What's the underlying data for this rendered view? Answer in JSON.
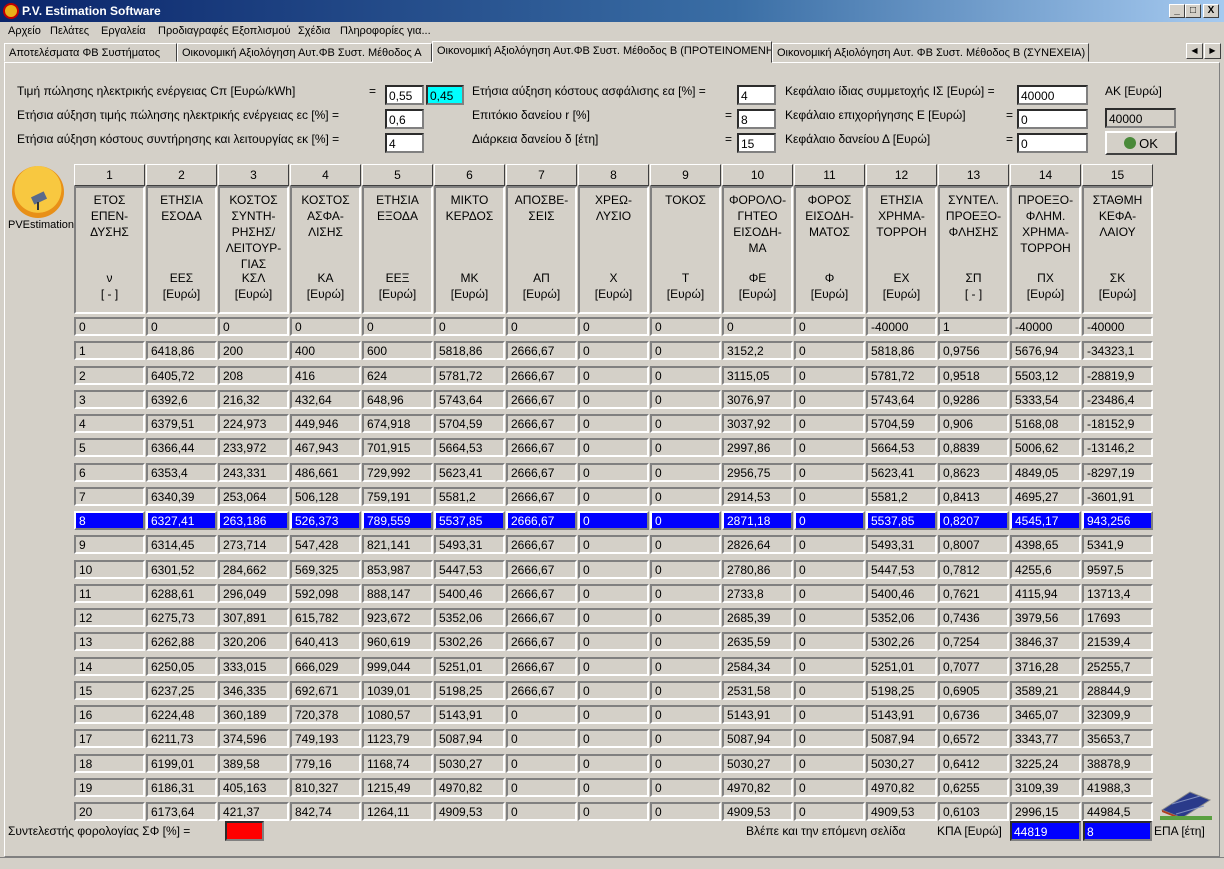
{
  "window": {
    "title": "P.V. Estimation Software",
    "min": "_",
    "max": "□",
    "close": "X"
  },
  "menu": [
    "Αρχείο",
    "Πελάτες",
    "Εργαλεία",
    "Προδιαγραφές Εξοπλισμού",
    "Σχέδια",
    "Πληροφορίες για..."
  ],
  "tabs": [
    "Αποτελέσματα ΦΒ Συστήματος",
    "Οικονομική Αξιολόγηση Αυτ.ΦΒ Συστ. Μέθοδος Α",
    "Οικονομική Αξιολόγηση Αυτ.ΦΒ Συστ. Μέθοδος Β (ΠΡΟΤΕΙΝΟΜΕΝΗ)",
    "Οικονομική Αξιολόγηση Αυτ. ΦΒ Συστ. Μέθοδος Β (ΣΥΝΕΧΕΙΑ)"
  ],
  "tab_arrows": {
    "left": "◀",
    "right": "▶"
  },
  "params": {
    "cn_label": "Τιμή πώλησης ηλεκτρικής ενέργειας Cπ [Ευρώ/kWh]",
    "cn_eq": "=",
    "cn_value": "0,55",
    "cn_value2": "0,45",
    "ec_label": "Ετήσια αύξηση τιμής πώλησης ηλεκτρικής ενέργειας εc [%] =",
    "ec_value": "0,6",
    "ek_label": "Ετήσια αύξηση κόστους συντήρησης και λειτουργίας εκ [%] =",
    "ek_value": "4",
    "ea_label": "Ετήσια αύξηση κόστους ασφάλισης εα [%] =",
    "ea_value": "4",
    "r_label": "Επιτόκιο δανείου r [%]",
    "r_eq": "=",
    "r_value": "8",
    "d_label": "Διάρκεια δανείου δ [έτη]",
    "d_eq": "=",
    "d_value": "15",
    "is_label": "Κεφάλαιο ίδιας συμμετοχής ΙΣ [Ευρώ] =",
    "is_value": "40000",
    "e_label": "Κεφάλαιο επιχορήγησης Ε [Ευρώ]",
    "e_eq": "=",
    "e_value": "0",
    "delta_label": "Κεφάλαιο δανείου Δ [Ευρώ]",
    "delta_eq": "=",
    "delta_value": "0",
    "ak_label": "ΑΚ [Ευρώ]",
    "ak_value": "40000",
    "ok_label": "OK"
  },
  "logo": {
    "caption": "PVEstimation"
  },
  "columns": [
    {
      "num": "1",
      "title": "ΕΤΟΣ\nΕΠΕΝ-\nΔΥΣΗΣ",
      "sym": "ν\n[ - ]"
    },
    {
      "num": "2",
      "title": "ΕΤΗΣΙΑ\nΕΣΟΔΑ",
      "sym": "ΕΕΣ\n[Ευρώ]"
    },
    {
      "num": "3",
      "title": "ΚΟΣΤΟΣ\nΣΥΝΤΗ-\nΡΗΣΗΣ/\nΛΕΙΤΟΥΡ-\nΓΙΑΣ",
      "sym": "ΚΣΛ\n[Ευρώ]"
    },
    {
      "num": "4",
      "title": "ΚΟΣΤΟΣ\nΑΣΦΑ-\nΛΙΣΗΣ",
      "sym": "ΚΑ\n[Ευρώ]"
    },
    {
      "num": "5",
      "title": "ΕΤΗΣΙΑ\nΕΞΟΔΑ",
      "sym": "ΕΕΞ\n[Ευρώ]"
    },
    {
      "num": "6",
      "title": "ΜΙΚΤΟ\nΚΕΡΔΟΣ",
      "sym": "ΜΚ\n[Ευρώ]"
    },
    {
      "num": "7",
      "title": "ΑΠΟΣΒΕ-\nΣΕΙΣ",
      "sym": "ΑΠ\n[Ευρώ]"
    },
    {
      "num": "8",
      "title": "ΧΡΕΩ-\nΛΥΣΙΟ",
      "sym": "Χ\n[Ευρώ]"
    },
    {
      "num": "9",
      "title": "ΤΟΚΟΣ",
      "sym": "Τ\n[Ευρώ]"
    },
    {
      "num": "10",
      "title": "ΦΟΡΟΛΟ-\nΓΗΤΕΟ\nΕΙΣΟΔΗ-\nΜΑ",
      "sym": "ΦΕ\n[Ευρώ]"
    },
    {
      "num": "11",
      "title": "ΦΟΡΟΣ\nΕΙΣΟΔΗ-\nΜΑΤΟΣ",
      "sym": "Φ\n[Ευρώ]"
    },
    {
      "num": "12",
      "title": "ΕΤΗΣΙΑ\nΧΡΗΜΑ-\nΤΟΡΡΟΗ",
      "sym": "ΕΧ\n[Ευρώ]"
    },
    {
      "num": "13",
      "title": "ΣΥΝΤΕΛ.\nΠΡΟΕΞΟ-\nΦΛΗΣΗΣ",
      "sym": "ΣΠ\n[ - ]"
    },
    {
      "num": "14",
      "title": "ΠΡΟΕΞΟ-\nΦΛΗΜ.\nΧΡΗΜΑ-\nΤΟΡΡΟΗ",
      "sym": "ΠΧ\n[Ευρώ]"
    },
    {
      "num": "15",
      "title": "ΣΤΑΘΜΗ\nΚΕΦΑ-\nΛΑΙΟΥ",
      "sym": "ΣΚ\n[Ευρώ]"
    }
  ],
  "selected_row": 8,
  "rows": [
    [
      "0",
      "0",
      "0",
      "0",
      "0",
      "0",
      "0",
      "0",
      "0",
      "0",
      "0",
      "-40000",
      "1",
      "-40000",
      "-40000"
    ],
    [
      "1",
      "6418,86",
      "200",
      "400",
      "600",
      "5818,86",
      "2666,67",
      "0",
      "0",
      "3152,2",
      "0",
      "5818,86",
      "0,9756",
      "5676,94",
      "-34323,1"
    ],
    [
      "2",
      "6405,72",
      "208",
      "416",
      "624",
      "5781,72",
      "2666,67",
      "0",
      "0",
      "3115,05",
      "0",
      "5781,72",
      "0,9518",
      "5503,12",
      "-28819,9"
    ],
    [
      "3",
      "6392,6",
      "216,32",
      "432,64",
      "648,96",
      "5743,64",
      "2666,67",
      "0",
      "0",
      "3076,97",
      "0",
      "5743,64",
      "0,9286",
      "5333,54",
      "-23486,4"
    ],
    [
      "4",
      "6379,51",
      "224,973",
      "449,946",
      "674,918",
      "5704,59",
      "2666,67",
      "0",
      "0",
      "3037,92",
      "0",
      "5704,59",
      "0,906",
      "5168,08",
      "-18152,9"
    ],
    [
      "5",
      "6366,44",
      "233,972",
      "467,943",
      "701,915",
      "5664,53",
      "2666,67",
      "0",
      "0",
      "2997,86",
      "0",
      "5664,53",
      "0,8839",
      "5006,62",
      "-13146,2"
    ],
    [
      "6",
      "6353,4",
      "243,331",
      "486,661",
      "729,992",
      "5623,41",
      "2666,67",
      "0",
      "0",
      "2956,75",
      "0",
      "5623,41",
      "0,8623",
      "4849,05",
      "-8297,19"
    ],
    [
      "7",
      "6340,39",
      "253,064",
      "506,128",
      "759,191",
      "5581,2",
      "2666,67",
      "0",
      "0",
      "2914,53",
      "0",
      "5581,2",
      "0,8413",
      "4695,27",
      "-3601,91"
    ],
    [
      "8",
      "6327,41",
      "263,186",
      "526,373",
      "789,559",
      "5537,85",
      "2666,67",
      "0",
      "0",
      "2871,18",
      "0",
      "5537,85",
      "0,8207",
      "4545,17",
      "943,256"
    ],
    [
      "9",
      "6314,45",
      "273,714",
      "547,428",
      "821,141",
      "5493,31",
      "2666,67",
      "0",
      "0",
      "2826,64",
      "0",
      "5493,31",
      "0,8007",
      "4398,65",
      "5341,9"
    ],
    [
      "10",
      "6301,52",
      "284,662",
      "569,325",
      "853,987",
      "5447,53",
      "2666,67",
      "0",
      "0",
      "2780,86",
      "0",
      "5447,53",
      "0,7812",
      "4255,6",
      "9597,5"
    ],
    [
      "11",
      "6288,61",
      "296,049",
      "592,098",
      "888,147",
      "5400,46",
      "2666,67",
      "0",
      "0",
      "2733,8",
      "0",
      "5400,46",
      "0,7621",
      "4115,94",
      "13713,4"
    ],
    [
      "12",
      "6275,73",
      "307,891",
      "615,782",
      "923,672",
      "5352,06",
      "2666,67",
      "0",
      "0",
      "2685,39",
      "0",
      "5352,06",
      "0,7436",
      "3979,56",
      "17693"
    ],
    [
      "13",
      "6262,88",
      "320,206",
      "640,413",
      "960,619",
      "5302,26",
      "2666,67",
      "0",
      "0",
      "2635,59",
      "0",
      "5302,26",
      "0,7254",
      "3846,37",
      "21539,4"
    ],
    [
      "14",
      "6250,05",
      "333,015",
      "666,029",
      "999,044",
      "5251,01",
      "2666,67",
      "0",
      "0",
      "2584,34",
      "0",
      "5251,01",
      "0,7077",
      "3716,28",
      "25255,7"
    ],
    [
      "15",
      "6237,25",
      "346,335",
      "692,671",
      "1039,01",
      "5198,25",
      "2666,67",
      "0",
      "0",
      "2531,58",
      "0",
      "5198,25",
      "0,6905",
      "3589,21",
      "28844,9"
    ],
    [
      "16",
      "6224,48",
      "360,189",
      "720,378",
      "1080,57",
      "5143,91",
      "0",
      "0",
      "0",
      "5143,91",
      "0",
      "5143,91",
      "0,6736",
      "3465,07",
      "32309,9"
    ],
    [
      "17",
      "6211,73",
      "374,596",
      "749,193",
      "1123,79",
      "5087,94",
      "0",
      "0",
      "0",
      "5087,94",
      "0",
      "5087,94",
      "0,6572",
      "3343,77",
      "35653,7"
    ],
    [
      "18",
      "6199,01",
      "389,58",
      "779,16",
      "1168,74",
      "5030,27",
      "0",
      "0",
      "0",
      "5030,27",
      "0",
      "5030,27",
      "0,6412",
      "3225,24",
      "38878,9"
    ],
    [
      "19",
      "6186,31",
      "405,163",
      "810,327",
      "1215,49",
      "4970,82",
      "0",
      "0",
      "0",
      "4970,82",
      "0",
      "4970,82",
      "0,6255",
      "3109,39",
      "41988,3"
    ],
    [
      "20",
      "6173,64",
      "421,37",
      "842,74",
      "1264,11",
      "4909,53",
      "0",
      "0",
      "0",
      "4909,53",
      "0",
      "4909,53",
      "0,6103",
      "2996,15",
      "44984,5"
    ]
  ],
  "footer": {
    "tax_label": "Συντελεστής φορολογίας ΣΦ [%] =",
    "tax_value": "0",
    "next_page": "Βλέπε και την επόμενη σελίδα",
    "kpa_label": "ΚΠΑ [Ευρώ]",
    "kpa_value": "44819",
    "epa_value": "8",
    "epa_label": "ΕΠΑ [έτη]"
  },
  "colors": {
    "selection": "#0000ff",
    "tax_input": "#ff0000",
    "cn_value2_bg": "#00ffff"
  }
}
